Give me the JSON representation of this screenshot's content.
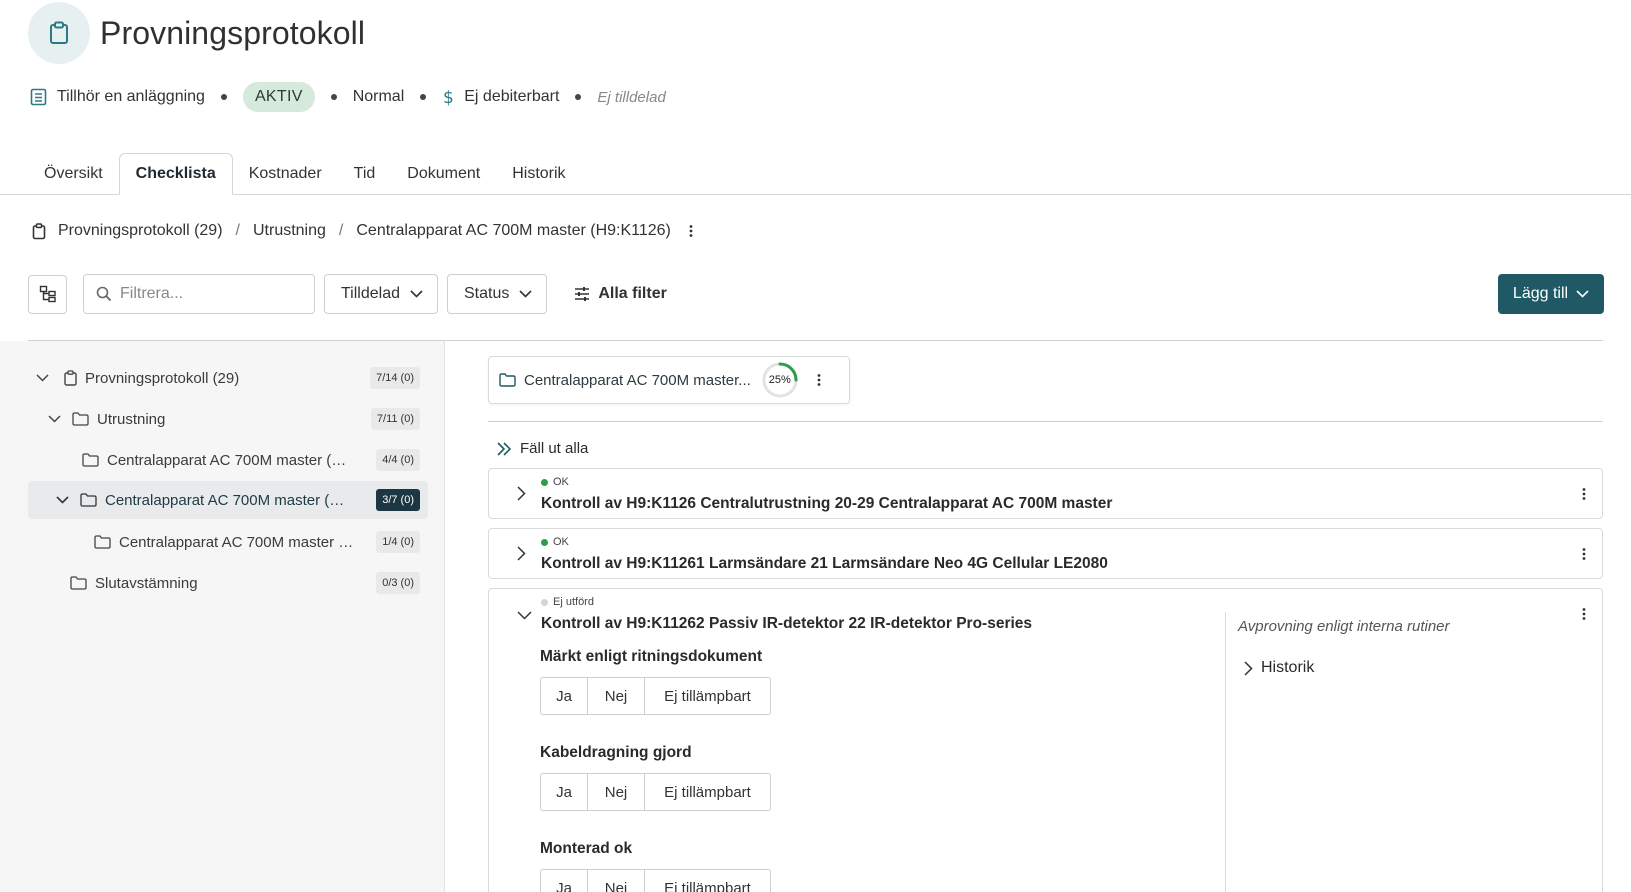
{
  "header": {
    "title": "Provningsprotokoll",
    "icon": "clipboard-icon"
  },
  "meta": {
    "facility": "Tillhör en anläggning",
    "status_badge": "AKTIV",
    "priority": "Normal",
    "billing": "Ej debiterbart",
    "assignee": "Ej tilldelad"
  },
  "tabs": [
    {
      "label": "Översikt",
      "active": false
    },
    {
      "label": "Checklista",
      "active": true
    },
    {
      "label": "Kostnader",
      "active": false
    },
    {
      "label": "Tid",
      "active": false
    },
    {
      "label": "Dokument",
      "active": false
    },
    {
      "label": "Historik",
      "active": false
    }
  ],
  "breadcrumb": {
    "items": [
      "Provningsprotokoll (29)",
      "Utrustning",
      "Centralapparat AC 700M master (H9:K1126)"
    ]
  },
  "toolbar": {
    "search_placeholder": "Filtrera...",
    "assigned_label": "Tilldelad",
    "status_label": "Status",
    "all_filters_label": "Alla filter",
    "add_label": "Lägg till"
  },
  "tree": [
    {
      "label": "Provningsprotokoll (29)",
      "count": "7/14 (0)",
      "expanded": true,
      "selected": false
    },
    {
      "label": "Utrustning",
      "count": "7/11 (0)",
      "expanded": true,
      "selected": false
    },
    {
      "label": "Centralapparat AC 700M master (H...",
      "count": "4/4 (0)",
      "expanded": false,
      "selected": false
    },
    {
      "label": "Centralapparat AC 700M master (H...",
      "count": "3/7 (0)",
      "expanded": true,
      "selected": true
    },
    {
      "label": "Centralapparat AC 700M master (...",
      "count": "1/4 (0)",
      "expanded": false,
      "selected": false
    },
    {
      "label": "Slutavstämning",
      "count": "0/3 (0)",
      "expanded": false,
      "selected": false
    }
  ],
  "content": {
    "card_title": "Centralapparat AC 700M master...",
    "progress_percent": 25,
    "progress_label": "25%",
    "expand_all_label": "Fäll ut alla",
    "accent_color": "#1f5965",
    "ok_color": "#2e9b4e",
    "items": [
      {
        "status": "OK",
        "title": "Kontroll av H9:K1126 Centralutrustning 20-29 Centralapparat AC 700M master",
        "expanded": false
      },
      {
        "status": "OK",
        "title": "Kontroll av H9:K11261 Larmsändare 21 Larmsändare Neo 4G Cellular LE2080",
        "expanded": false
      },
      {
        "status": "Ej utförd",
        "title": "Kontroll av H9:K11262 Passiv IR-detektor 22 IR-detektor Pro-series",
        "expanded": true
      }
    ],
    "questions": [
      {
        "label": "Märkt enligt ritningsdokument",
        "options": [
          "Ja",
          "Nej",
          "Ej tillämpbart"
        ]
      },
      {
        "label": "Kabeldragning gjord",
        "options": [
          "Ja",
          "Nej",
          "Ej tillämpbart"
        ]
      },
      {
        "label": "Monterad ok",
        "options": [
          "Ja",
          "Nej",
          "Ej tillämpbart"
        ]
      }
    ],
    "side_note": "Avprovning enligt interna rutiner",
    "history_label": "Historik"
  }
}
